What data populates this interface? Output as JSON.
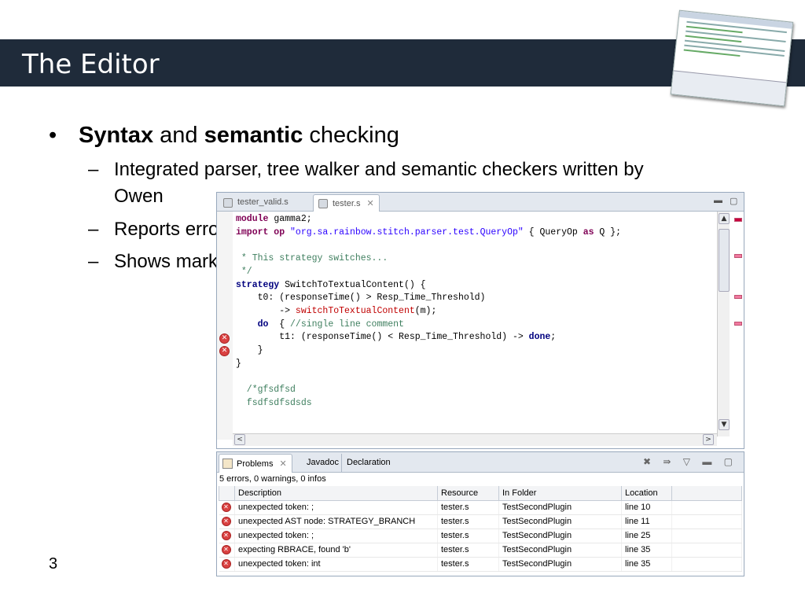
{
  "slide": {
    "title": "The Editor",
    "page_number": "3"
  },
  "bullets": {
    "main": {
      "bullet": "•",
      "bold1": "Syntax",
      "and": " and ",
      "bold2": "semantic",
      "rest": " checking"
    },
    "subs": [
      {
        "dash": "–",
        "text": "Integrated parser, tree walker and semantic checkers written by"
      },
      {
        "dash": "",
        "text": "Owen"
      },
      {
        "dash": "–",
        "text": "Reports errors and warnings to the problems view"
      },
      {
        "dash": "–",
        "text": "Shows markers in the gutter"
      }
    ]
  },
  "editor": {
    "tabs": [
      {
        "label": "tester_valid.s",
        "close": ""
      },
      {
        "label": "tester.s",
        "close": "✕"
      }
    ],
    "controls": {
      "minimize": "▬",
      "maximize": "▢"
    },
    "code": {
      "l1_kw": "module",
      "l1_rest": " gamma2;",
      "l2_kw": "import op",
      "l2_str": " \"org.sa.rainbow.stitch.parser.test.QueryOp\"",
      "l2_rest": " { QueryOp ",
      "l2_as": "as",
      "l2_end": " Q };",
      "l4_cm": " * This strategy switches...",
      "l5_cm": " */",
      "l6_kw": "strategy",
      "l6_rest": " SwitchToTextualContent() {",
      "l7": "    t0: (responseTime() > Resp_Time_Threshold)",
      "l8_pre": "        -> ",
      "l8_red": "switchToTextualContent",
      "l8_rest": "(m);",
      "l9_kw": "    do",
      "l9_mid": "  { ",
      "l9_cm": "//single line comment",
      "l10_pre": "        t1: (responseTime() < Resp_Time_Threshold) -> ",
      "l10_kw": "done",
      "l10_end": ";",
      "l11": "    }",
      "l12": "}",
      "l14_cm": "  /*gfsdfsd",
      "l15_cm": "  fsdfsdfsdsds"
    },
    "gutter_marker_glyph": "✕",
    "scroll": {
      "up": "▲",
      "down": "▼",
      "left": "<",
      "right": ">",
      "grip": "≡"
    }
  },
  "problems": {
    "tabs": [
      {
        "label": "Problems",
        "close": "✕"
      },
      {
        "label": "Javadoc"
      },
      {
        "label": "Declaration"
      }
    ],
    "toolbar": "✖ ⇛ ▽ ▬ ▢",
    "summary": "5 errors, 0 warnings, 0 infos",
    "columns": [
      "Description",
      "Resource",
      "In Folder",
      "Location"
    ],
    "rows": [
      {
        "description": "unexpected token: ;",
        "resource": "tester.s",
        "folder": "TestSecondPlugin",
        "location": "line 10"
      },
      {
        "description": "unexpected AST node: STRATEGY_BRANCH",
        "resource": "tester.s",
        "folder": "TestSecondPlugin",
        "location": "line 11"
      },
      {
        "description": "unexpected token: ;",
        "resource": "tester.s",
        "folder": "TestSecondPlugin",
        "location": "line 25"
      },
      {
        "description": "expecting RBRACE, found 'b'",
        "resource": "tester.s",
        "folder": "TestSecondPlugin",
        "location": "line 35"
      },
      {
        "description": "unexpected token: int",
        "resource": "tester.s",
        "folder": "TestSecondPlugin",
        "location": "line 35"
      }
    ]
  },
  "colors": {
    "title_bar": "#1f2b3a",
    "keyword": "#7f0055",
    "string": "#2a00ff",
    "comment": "#3f7f5f",
    "error": "#d94141"
  }
}
